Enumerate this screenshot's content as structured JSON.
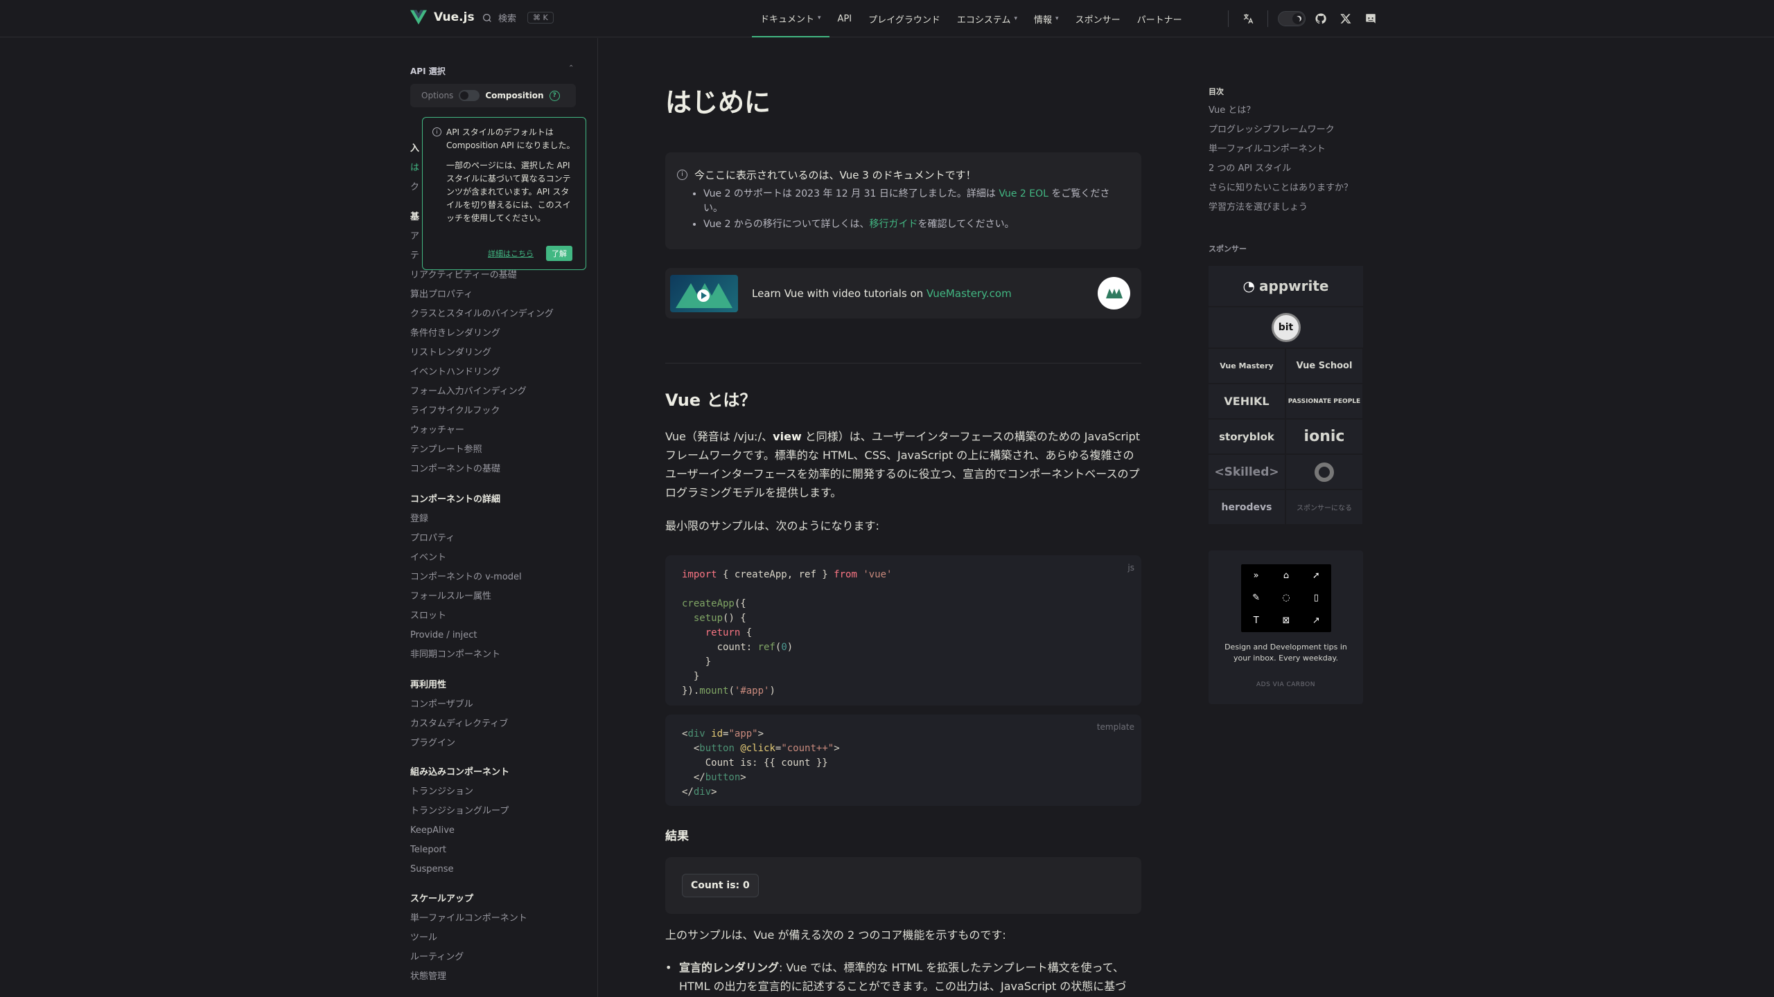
{
  "header": {
    "site_name": "Vue.js",
    "search_label": "検索",
    "search_shortcut": "⌘ K",
    "nav": [
      {
        "label": "ドキュメント",
        "dropdown": true,
        "active": true
      },
      {
        "label": "API",
        "dropdown": false
      },
      {
        "label": "プレイグラウンド",
        "dropdown": false
      },
      {
        "label": "エコシステム",
        "dropdown": true
      },
      {
        "label": "情報",
        "dropdown": true
      },
      {
        "label": "スポンサー",
        "dropdown": false
      },
      {
        "label": "パートナー",
        "dropdown": false
      }
    ],
    "icons": [
      "translate-icon",
      "dark-mode-toggle",
      "github-icon",
      "x-twitter-icon",
      "discord-icon"
    ]
  },
  "sidebar": {
    "api_pref_title": "API 選択",
    "options_label": "Options",
    "composition_label": "Composition",
    "help_glyph": "?",
    "popup": {
      "text1": "API スタイルのデフォルトは Composition API になりました。",
      "text2": "一部のページには、選択した API スタイルに基づいて異なるコンテンツが含まれています。API スタイルを切り替えるには、このスイッチを使用してください。",
      "link": "詳細はこちら",
      "button": "了解"
    },
    "partial_items": {
      "s1_title": "入",
      "s1_item1": "は",
      "s1_item2": "ク",
      "s2_title": "基",
      "s2_item1": "ア",
      "s2_item2": "テ"
    },
    "basics_items": [
      "リアクティビティーの基礎",
      "算出プロパティ",
      "クラスとスタイルのバインディング",
      "条件付きレンダリング",
      "リストレンダリング",
      "イベントハンドリング",
      "フォーム入力バインディング",
      "ライフサイクルフック",
      "ウォッチャー",
      "テンプレート参照",
      "コンポーネントの基礎"
    ],
    "sections": [
      {
        "title": "コンポーネントの詳細",
        "items": [
          "登録",
          "プロパティ",
          "イベント",
          "コンポーネントの v-model",
          "フォールスルー属性",
          "スロット",
          "Provide / inject",
          "非同期コンポーネント"
        ]
      },
      {
        "title": "再利用性",
        "items": [
          "コンポーザブル",
          "カスタムディレクティブ",
          "プラグイン"
        ]
      },
      {
        "title": "組み込みコンポーネント",
        "items": [
          "トランジション",
          "トランジショングループ",
          "KeepAlive",
          "Teleport",
          "Suspense"
        ]
      },
      {
        "title": "スケールアップ",
        "items": [
          "単一ファイルコンポーネント",
          "ツール",
          "ルーティング",
          "状態管理"
        ]
      }
    ]
  },
  "main": {
    "title": "はじめに",
    "info": {
      "title": "今ここに表示されているのは、Vue 3 のドキュメントです！",
      "item1_pre": "Vue 2 のサポートは 2023 年 12 月 31 日に終了しました。詳細は ",
      "item1_link": "Vue 2 EOL",
      "item1_post": " をご覧ください。",
      "item2_pre": "Vue 2 からの移行について詳しくは、",
      "item2_link": "移行ガイド",
      "item2_post": "を確認してください。"
    },
    "banner": {
      "text": "Learn Vue with video tutorials on ",
      "link": "VueMastery.com"
    },
    "h2": "Vue とは？",
    "p1_a": "Vue（発音は /vjuː/、",
    "p1_b": "view",
    "p1_c": " と同様）は、ユーザーインターフェースの構築のための JavaScript フレームワークです。標準的な HTML、CSS、JavaScript の上に構築され、あらゆる複雑さのユーザーインターフェースを効率的に開発するのに役立つ、宣言的でコンポーネントベースのプログラミングモデルを提供します。",
    "p2": "最小限のサンプルは、次のようになります:",
    "code_js_lang": "js",
    "code_tpl_lang": "template",
    "h3": "結果",
    "count_button": "Count is: 0",
    "p3": "上のサンプルは、Vue が備える次の 2 つのコア機能を示すものです:",
    "bullet_title": "宣言的レンダリング",
    "bullet_text": ": Vue では、標準的な HTML を拡張したテンプレート構文を使って、HTML の出力を宣言的に記述することができます。この出力は、JavaScript の状態に基づ"
  },
  "toc": {
    "title": "目次",
    "items": [
      "Vue とは？",
      "プログレッシブフレームワーク",
      "単一ファイルコンポーネント",
      "2 つの API スタイル",
      "さらに知りたいことはありますか？",
      "学習方法を選びましょう"
    ]
  },
  "sponsors": {
    "title": "スポンサー",
    "full": [
      "appwrite",
      "bit"
    ],
    "pairs": [
      [
        "Vue Mastery",
        "Vue School"
      ],
      [
        "VEHIKL",
        "PASSIONATE PEOPLE"
      ],
      [
        "storyblok",
        "ionic"
      ],
      [
        "<Skilled>",
        ""
      ],
      [
        "herodevs",
        "スポンサーになる"
      ]
    ]
  },
  "carbon": {
    "text": "Design and Development tips in your inbox. Every weekday.",
    "via": "ADS VIA CARBON"
  },
  "colors": {
    "accent": "#42b883",
    "bg": "#1b1b1f",
    "soft_bg": "#232327"
  }
}
